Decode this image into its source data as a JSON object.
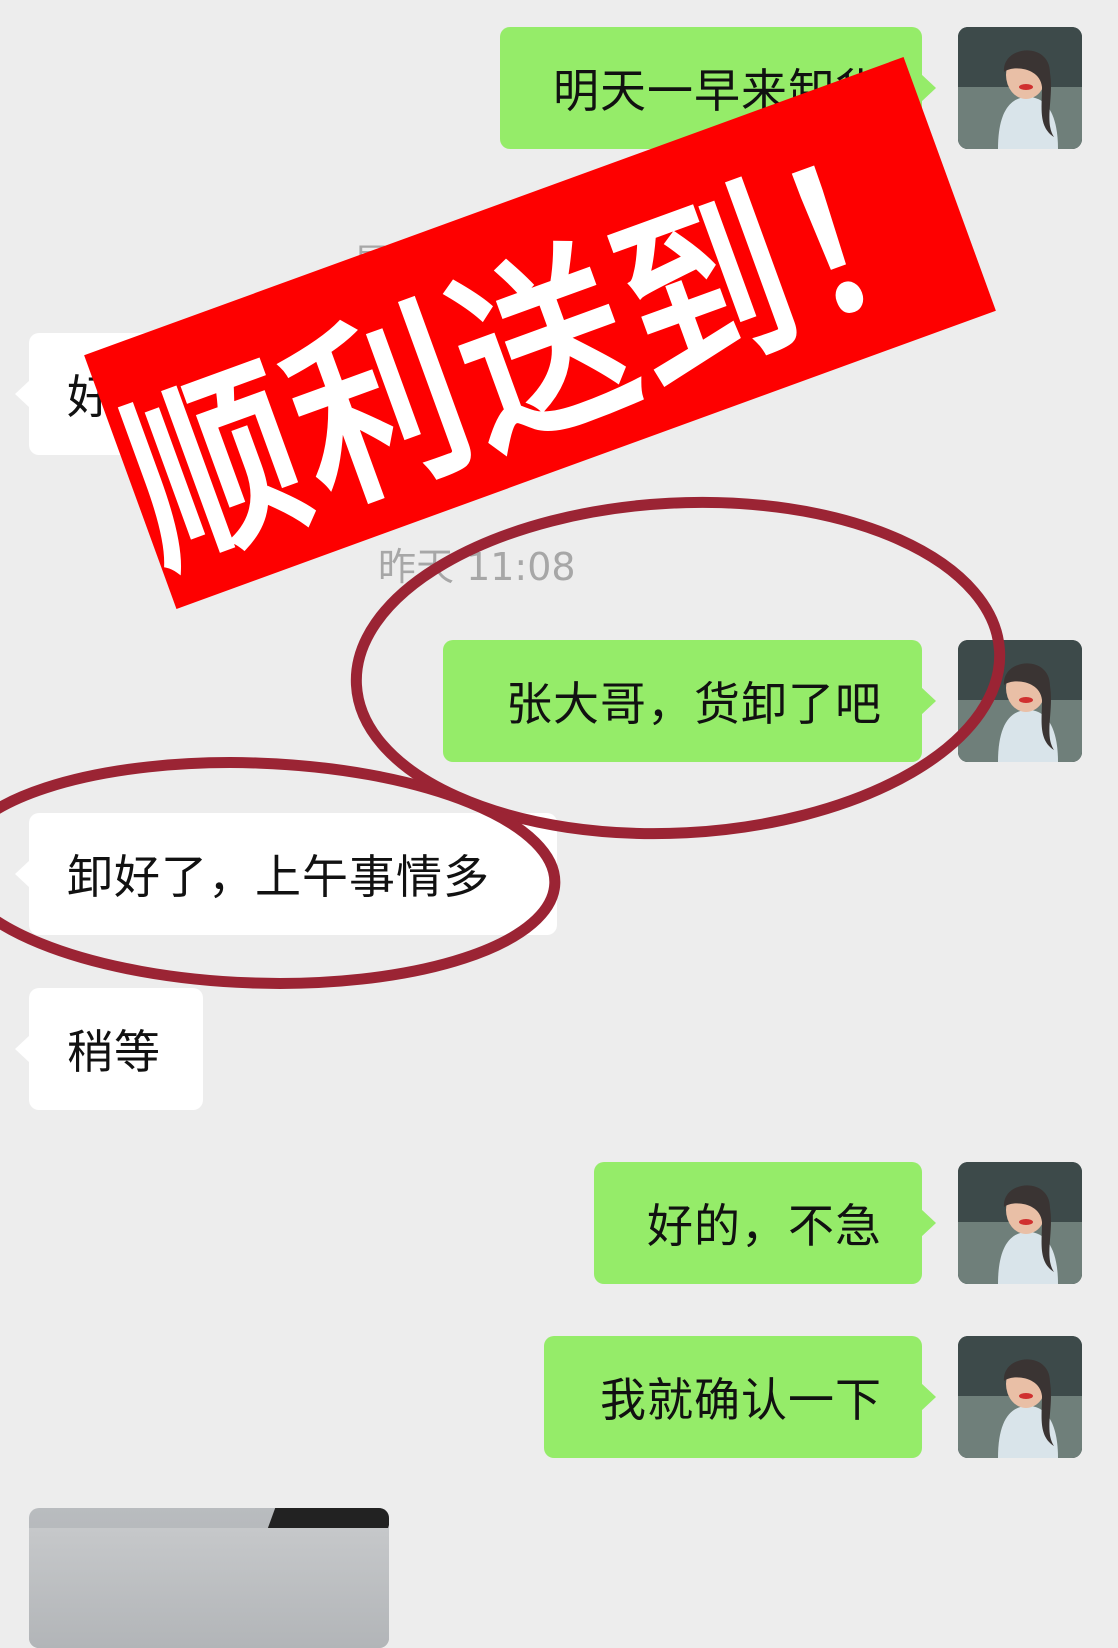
{
  "messages": [
    {
      "id": "m1",
      "direction": "out",
      "text": "明天一早来卸货"
    },
    {
      "id": "m2",
      "direction": "in",
      "text": "好"
    },
    {
      "id": "m3",
      "direction": "out",
      "text": "张大哥，货卸了吧"
    },
    {
      "id": "m4",
      "direction": "in",
      "text": "卸好了，上午事情多"
    },
    {
      "id": "m5",
      "direction": "in",
      "text": "稍等"
    },
    {
      "id": "m6",
      "direction": "out",
      "text": "好的，不急"
    },
    {
      "id": "m7",
      "direction": "out",
      "text": "我就确认一下"
    }
  ],
  "timestamps": {
    "weekday": "星期",
    "yesterday": "昨天 11:08"
  },
  "overlay": {
    "banner_text": "顺利送到！",
    "banner_color": "#fe0000",
    "annotation_color": "#9b2434"
  },
  "colors": {
    "outgoing_bubble": "#95ec69",
    "incoming_bubble": "#ffffff",
    "background": "#ededed"
  }
}
